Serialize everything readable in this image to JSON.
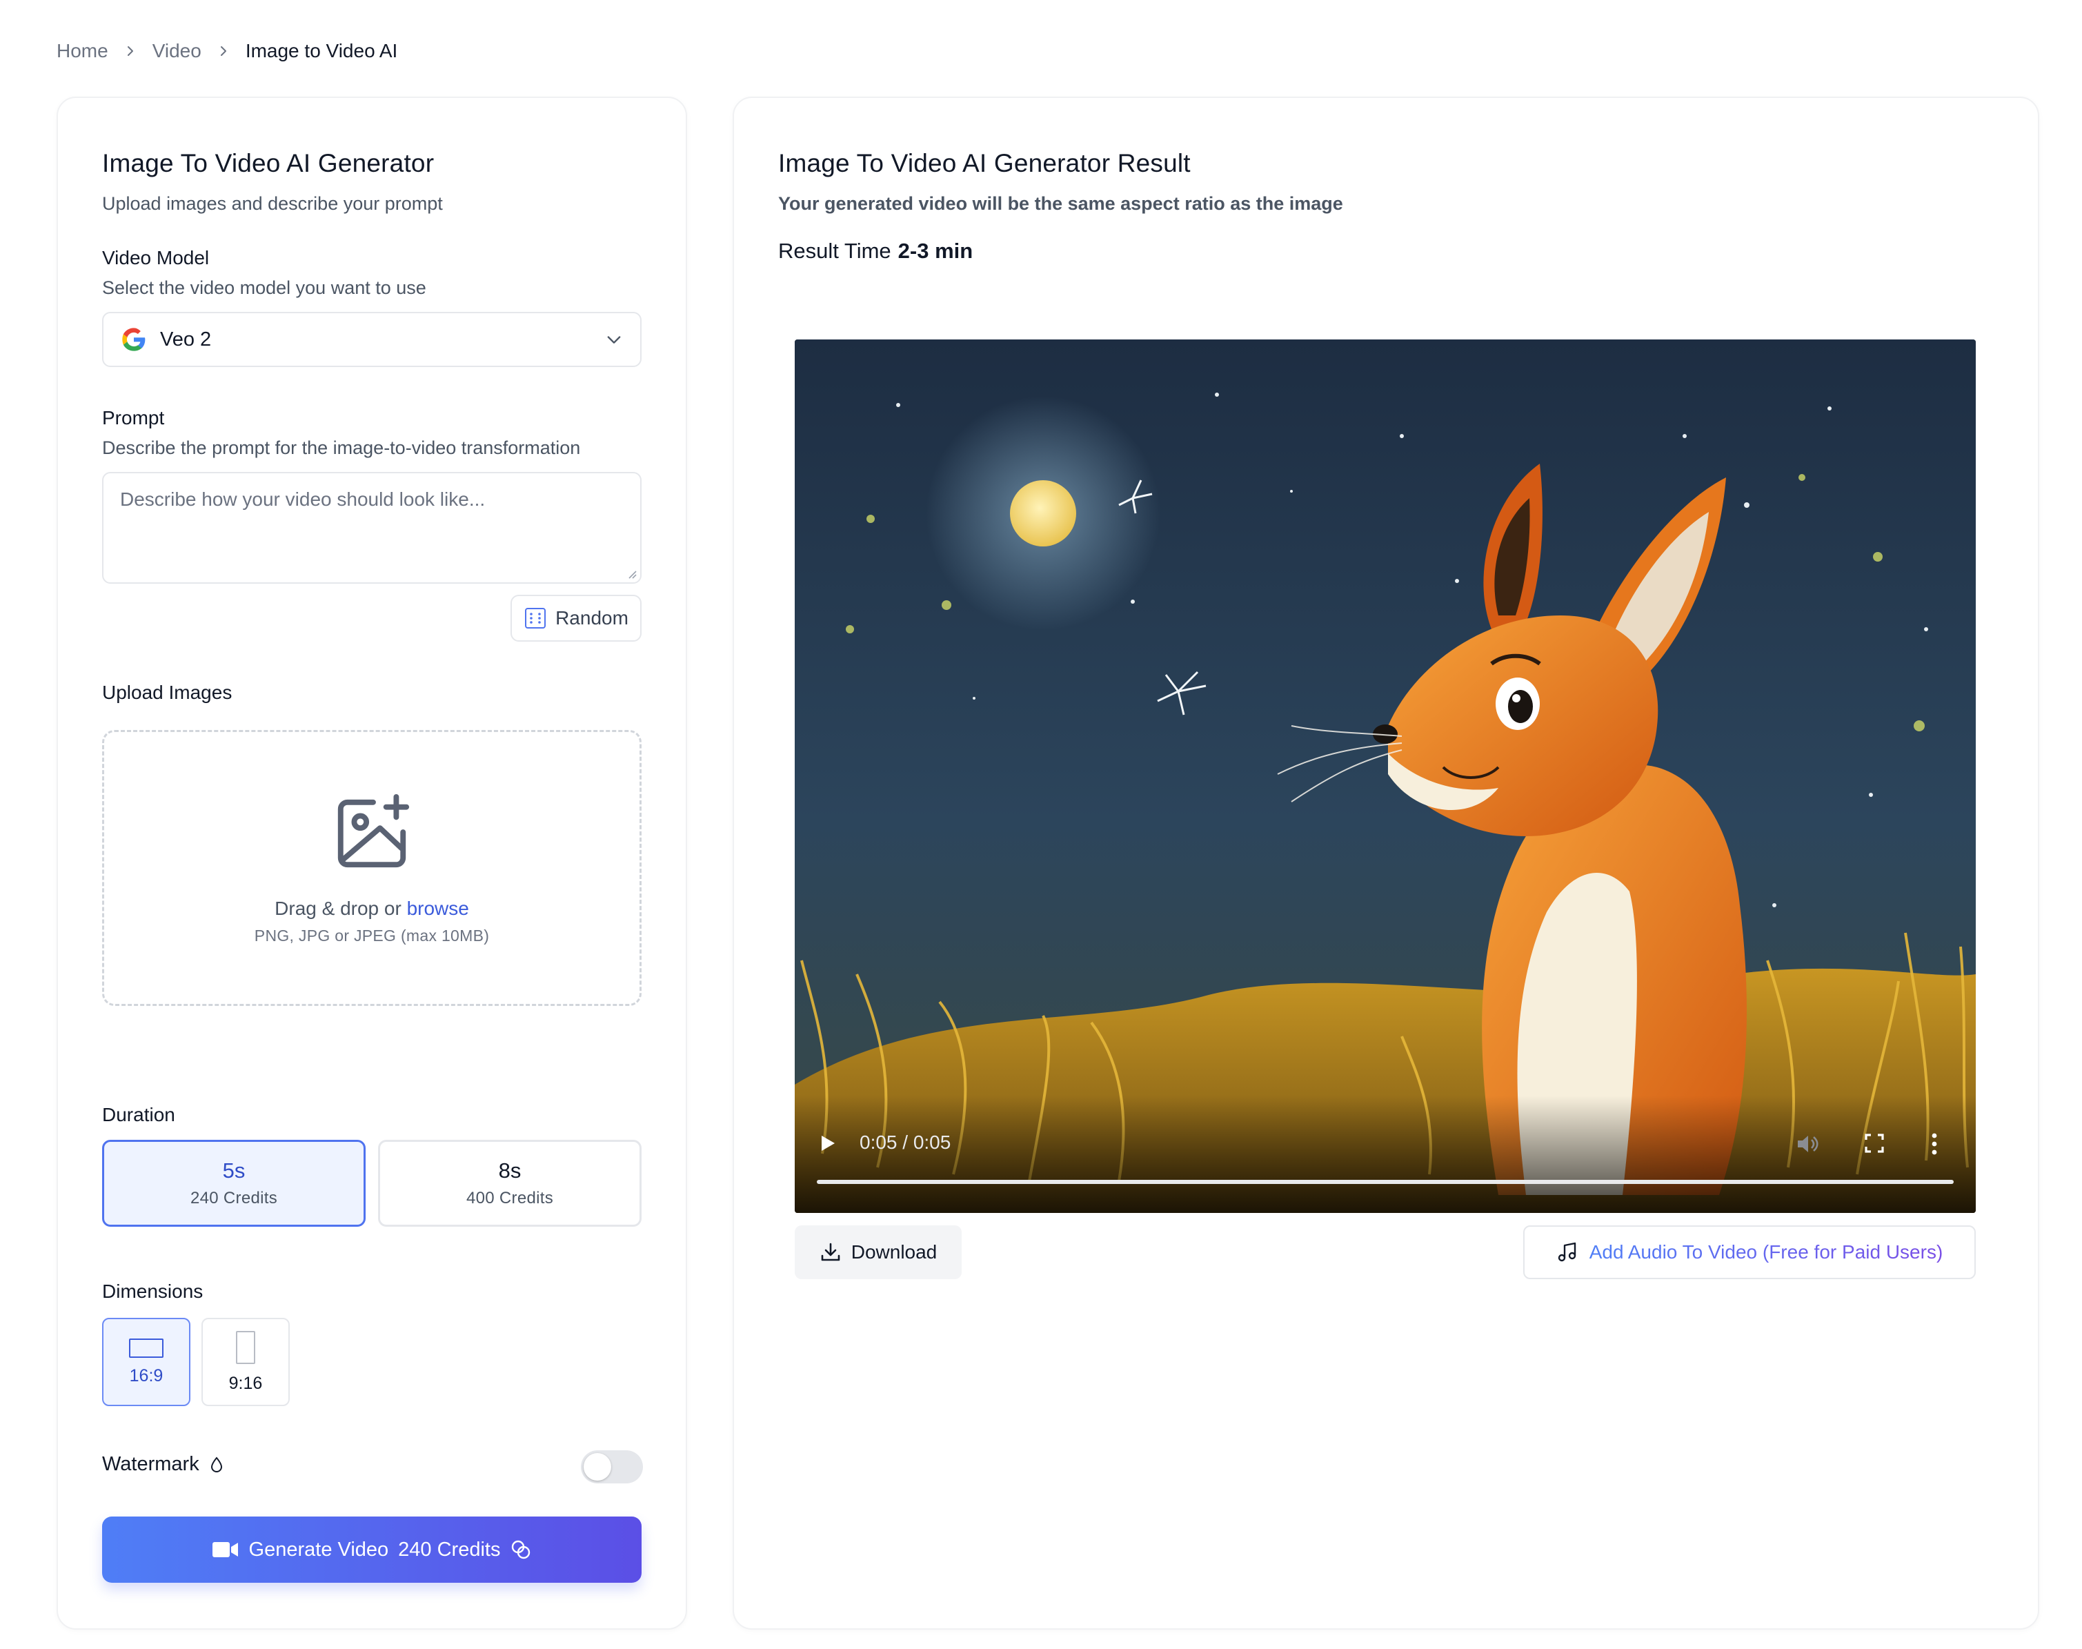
{
  "breadcrumb": {
    "items": [
      "Home",
      "Video",
      "Image to Video AI"
    ]
  },
  "left": {
    "title": "Image To Video AI Generator",
    "subtitle": "Upload images and describe your prompt",
    "model": {
      "label": "Video Model",
      "hint": "Select the video model you want to use",
      "selected": "Veo 2",
      "icon": "google-icon"
    },
    "prompt": {
      "label": "Prompt",
      "hint": "Describe the prompt for the image-to-video transformation",
      "placeholder": "Describe how your video should look like...",
      "value": ""
    },
    "random_label": "Random",
    "upload": {
      "label": "Upload Images",
      "drag_text": "Drag & drop or",
      "browse": "browse",
      "formats": "PNG, JPG or JPEG (max 10MB)"
    },
    "duration": {
      "label": "Duration",
      "options": [
        {
          "value": "5s",
          "credits": "240 Credits",
          "selected": true
        },
        {
          "value": "8s",
          "credits": "400 Credits",
          "selected": false
        }
      ]
    },
    "dimensions": {
      "label": "Dimensions",
      "options": [
        {
          "value": "16:9",
          "selected": true
        },
        {
          "value": "9:16",
          "selected": false
        }
      ]
    },
    "watermark": {
      "label": "Watermark",
      "enabled": false
    },
    "generate": {
      "label": "Generate Video",
      "credits": "240 Credits"
    }
  },
  "right": {
    "title": "Image To Video AI Generator Result",
    "subtitle": "Your generated video will be the same aspect ratio as the image",
    "result_time_label": "Result Time",
    "result_time_value": "2-3 min",
    "video": {
      "time": "0:05 / 0:05",
      "progress": 1.0,
      "description": "cartoon fox in golden grass under a starry night sky with a full moon"
    },
    "download_label": "Download",
    "audio_label": "Add Audio To Video (Free for Paid Users)"
  },
  "colors": {
    "accent": "#4f73ef",
    "accent_bg": "#eef3ff",
    "gradient_start": "#4f7ef6",
    "gradient_end": "#5b4fe6",
    "link": "#3b5bdb",
    "border": "#e5e7eb"
  }
}
